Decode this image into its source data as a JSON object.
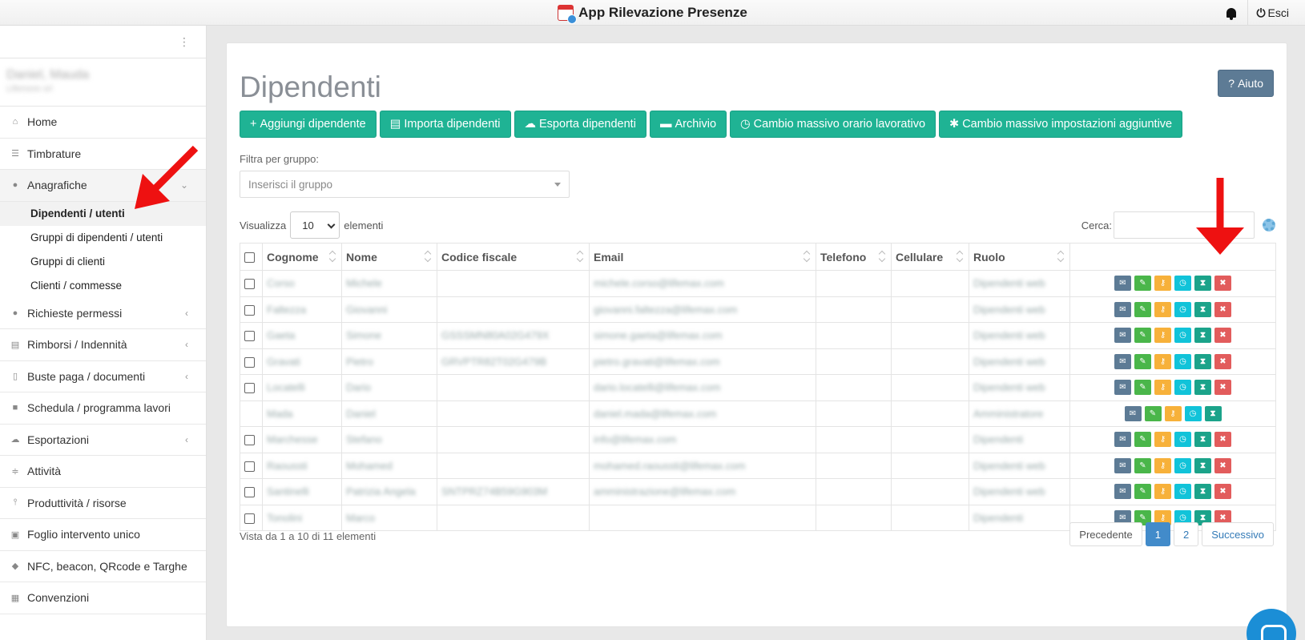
{
  "app": {
    "title": "App Rilevazione Presenze",
    "logout_label": "Esci"
  },
  "sidebar": {
    "user_name": "Daniel, Mauda",
    "user_sub": "Lifemore srl",
    "items": [
      {
        "label": "Home",
        "icon": "home-icon"
      },
      {
        "label": "Timbrature",
        "icon": "list-icon"
      },
      {
        "label": "Anagrafiche",
        "icon": "users-icon"
      },
      {
        "label": "Richieste permessi",
        "icon": "comment-icon"
      },
      {
        "label": "Rimborsi / Indennità",
        "icon": "book-icon"
      },
      {
        "label": "Buste paga / documenti",
        "icon": "file-icon"
      },
      {
        "label": "Schedula / programma lavori",
        "icon": "briefcase-icon"
      },
      {
        "label": "Esportazioni",
        "icon": "cloud-icon"
      },
      {
        "label": "Attività",
        "icon": "sliders-icon"
      },
      {
        "label": "Produttività / risorse",
        "icon": "thermometer-icon"
      },
      {
        "label": "Foglio intervento unico",
        "icon": "image-icon"
      },
      {
        "label": "NFC, beacon, QRcode e Targhe",
        "icon": "tag-icon"
      },
      {
        "label": "Convenzioni",
        "icon": "gift-icon"
      }
    ],
    "subitems": [
      {
        "label": "Dipendenti / utenti"
      },
      {
        "label": "Gruppi di dipendenti / utenti"
      },
      {
        "label": "Gruppi di clienti"
      },
      {
        "label": "Clienti / commesse"
      }
    ]
  },
  "main": {
    "title": "Dipendenti",
    "help_label": "Aiuto",
    "toolbar": [
      {
        "label": "Aggiungi dipendente",
        "icon": "plus-icon"
      },
      {
        "label": "Importa dipendenti",
        "icon": "excel-file-icon"
      },
      {
        "label": "Esporta dipendenti",
        "icon": "cloud-download-icon"
      },
      {
        "label": "Archivio",
        "icon": "archive-icon"
      },
      {
        "label": "Cambio massivo orario lavorativo",
        "icon": "clock-icon"
      },
      {
        "label": "Cambio massivo impostazioni aggiuntive",
        "icon": "gear-icon"
      }
    ],
    "filter_label": "Filtra per gruppo:",
    "filter_placeholder": "Inserisci il gruppo",
    "show_label": "Visualizza",
    "page_length": "10",
    "elements_label": "elementi",
    "search_label": "Cerca:",
    "search_value": "",
    "columns": [
      "Cognome",
      "Nome",
      "Codice fiscale",
      "Email",
      "Telefono",
      "Cellulare",
      "Ruolo"
    ],
    "rows": [
      {
        "cognome": "Corso",
        "nome": "Michele",
        "cf": "",
        "email": "michele.corso@lifemax.com",
        "tel": "",
        "cell": "",
        "ruolo": "Dipendenti web",
        "checkbox": true,
        "delete": true
      },
      {
        "cognome": "Faltezza",
        "nome": "Giovanni",
        "cf": "",
        "email": "giovanni.faltezza@lifemax.com",
        "tel": "",
        "cell": "",
        "ruolo": "Dipendenti web",
        "checkbox": true,
        "delete": true
      },
      {
        "cognome": "Gaeta",
        "nome": "Simone",
        "cf": "GSSSMN80A02G479X",
        "email": "simone.gaeta@lifemax.com",
        "tel": "",
        "cell": "",
        "ruolo": "Dipendenti web",
        "checkbox": true,
        "delete": true
      },
      {
        "cognome": "Gravati",
        "nome": "Pietro",
        "cf": "GRVPTR82T02G479B",
        "email": "pietro.gravati@lifemax.com",
        "tel": "",
        "cell": "",
        "ruolo": "Dipendenti web",
        "checkbox": true,
        "delete": true
      },
      {
        "cognome": "Locatelli",
        "nome": "Dario",
        "cf": "",
        "email": "dario.locatelli@lifemax.com",
        "tel": "",
        "cell": "",
        "ruolo": "Dipendenti web",
        "checkbox": true,
        "delete": true
      },
      {
        "cognome": "Mada",
        "nome": "Daniel",
        "cf": "",
        "email": "daniel.mada@lifemax.com",
        "tel": "",
        "cell": "",
        "ruolo": "Amministratore",
        "checkbox": false,
        "delete": false
      },
      {
        "cognome": "Marchesse",
        "nome": "Stefano",
        "cf": "",
        "email": "info@lifemax.com",
        "tel": "",
        "cell": "",
        "ruolo": "Dipendenti",
        "checkbox": true,
        "delete": true
      },
      {
        "cognome": "Raoussti",
        "nome": "Mohamed",
        "cf": "",
        "email": "mohamed.raoussti@lifemax.com",
        "tel": "",
        "cell": "",
        "ruolo": "Dipendenti web",
        "checkbox": true,
        "delete": true
      },
      {
        "cognome": "Santinelli",
        "nome": "Patrizia Angela",
        "cf": "SNTPRZ74B59G903M",
        "email": "amministrazione@lifemax.com",
        "tel": "",
        "cell": "",
        "ruolo": "Dipendenti web",
        "checkbox": true,
        "delete": true
      },
      {
        "cognome": "Tonolini",
        "nome": "Marco",
        "cf": "",
        "email": "",
        "tel": "",
        "cell": "",
        "ruolo": "Dipendenti",
        "checkbox": true,
        "delete": true
      }
    ],
    "info_text": "Vista da 1 a 10 di 11 elementi",
    "pagination": {
      "prev": "Precedente",
      "pages": [
        "1",
        "2"
      ],
      "active": "1",
      "next": "Successivo"
    }
  },
  "colors": {
    "teal": "#1fb394",
    "slate": "#5d7b95",
    "green": "#4ab64a",
    "orange": "#f7b13a",
    "cyan": "#11c3d9",
    "dark_teal": "#1ba38a",
    "red": "#e25c5c",
    "arrow": "#ee1111"
  }
}
